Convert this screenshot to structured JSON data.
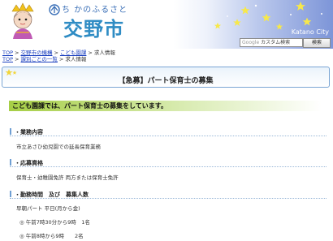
{
  "header": {
    "tagline": "ち かのふるさと",
    "city_name": "交野市",
    "city_en": "Katano City"
  },
  "search": {
    "placeholder_brand": "Google",
    "placeholder": "カスタム検索",
    "button_label": "検索"
  },
  "breadcrumbs": [
    {
      "items": [
        "TOP",
        "交野市の機構",
        "こども園課",
        "求人情報"
      ]
    },
    {
      "items": [
        "TOP",
        "課別ごとの一覧",
        "求人情報"
      ]
    }
  ],
  "page_title": "【急募】パート保育士の募集",
  "lead": "こども園課では、パート保育士の募集をしています。",
  "sections": [
    {
      "heading": "・業務内容",
      "lines": [
        "市立あさひ幼児園での延長保育業務"
      ]
    },
    {
      "heading": "・応募資格",
      "lines": [
        "保育士・幼稚園免許 両方または保育士免許"
      ]
    },
    {
      "heading": "・勤務時間　及び　募集人数",
      "lines": [
        "早朝パート 平日(月から金)",
        "◎ 午前7時30分から9時　1名",
        "◎ 午前8時から9時　　2名"
      ]
    }
  ],
  "colors": {
    "link": "#1a3fbf",
    "accent_blue": "#6f9fd3",
    "lead_green": "#a6ce45",
    "star_yellow": "#f7e84a"
  }
}
